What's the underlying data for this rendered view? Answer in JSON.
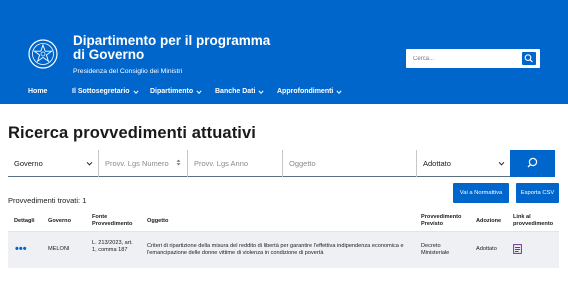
{
  "header": {
    "title": "Dipartimento per il programma di Governo",
    "subtitle": "Presidenza del Consiglio dei Ministri",
    "search_placeholder": "Cerca...",
    "bg_color": "#0066cc"
  },
  "nav": {
    "items": [
      {
        "label": "Home"
      },
      {
        "label": "Il Sottosegretario"
      },
      {
        "label": "Dipartimento"
      },
      {
        "label": "Banche Dati"
      },
      {
        "label": "Approfondimenti"
      }
    ]
  },
  "main": {
    "page_title": "Ricerca provvedimenti attuativi",
    "filters": {
      "governo_value": "Governo",
      "provv_numero_placeholder": "Provv. Lgs Numero",
      "provv_anno_placeholder": "Provv. Lgs Anno",
      "oggetto_placeholder": "Oggetto",
      "stato_value": "Adottato"
    },
    "found_text": "Provvedimenti trovati: 1",
    "vai_normativa_label": "Vai a Normattiva",
    "esporta_csv_label": "Esporta CSV"
  },
  "table": {
    "headers": {
      "dettagli": "Dettagli",
      "governo": "Governo",
      "fonte": "Fonte Provvedimento",
      "oggetto": "Oggetto",
      "provv_previsto": "Provvedimento Previsto",
      "adozione": "Adozione",
      "link": "Link al provvedimento"
    },
    "rows": [
      {
        "dettagli": "•••",
        "governo": "MELONI",
        "fonte": "L. 213/2023, art. 1, comma 187",
        "oggetto": "Criteri di ripartizione della misura del reddito di libertà per garantire l'effettiva indipendenza economica e l'emancipazione delle donne vittime di violenza in condizione di povertà",
        "provv_previsto": "Decreto Ministeriale",
        "adozione": "Adottato"
      }
    ]
  }
}
